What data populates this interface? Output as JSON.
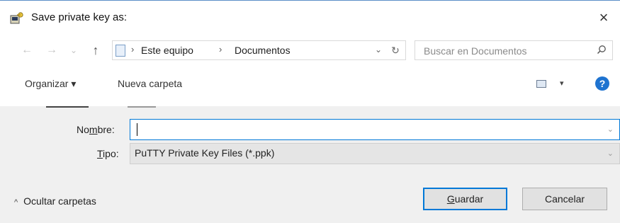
{
  "window": {
    "title": "Save private key as:",
    "close_symbol": "×",
    "app_icon": "putty-keygen-icon"
  },
  "navigation": {
    "back_symbol": "←",
    "forward_symbol": "→",
    "recent_symbol": "⌄",
    "up_symbol": "↑",
    "breadcrumb": [
      "Este equipo",
      "Documentos"
    ],
    "separator": "›",
    "dropdown_symbol": "⌄",
    "refresh_symbol": "↻"
  },
  "search": {
    "placeholder": "Buscar en Documentos",
    "icon": "search-icon"
  },
  "toolbar": {
    "organize_label": "Organizar ▾",
    "new_folder_label": "Nueva carpeta",
    "view_icon": "view-options-icon",
    "view_caret": "▾",
    "help_symbol": "?"
  },
  "form": {
    "name_label_pre": "No",
    "name_label_access": "m",
    "name_label_post": "bre:",
    "name_value": "",
    "type_label_access": "T",
    "type_label_post": "ipo:",
    "type_value": "PuTTY Private Key Files (*.ppk)",
    "dropdown_symbol": "⌄"
  },
  "footer": {
    "hide_folders_chevron": "^",
    "hide_folders_label": "Ocultar carpetas",
    "save_label_access": "G",
    "save_label_rest": "uardar",
    "cancel_label": "Cancelar"
  },
  "colors": {
    "accent": "#0078d7",
    "panel": "#f0f0f0",
    "help": "#1e73d0"
  }
}
